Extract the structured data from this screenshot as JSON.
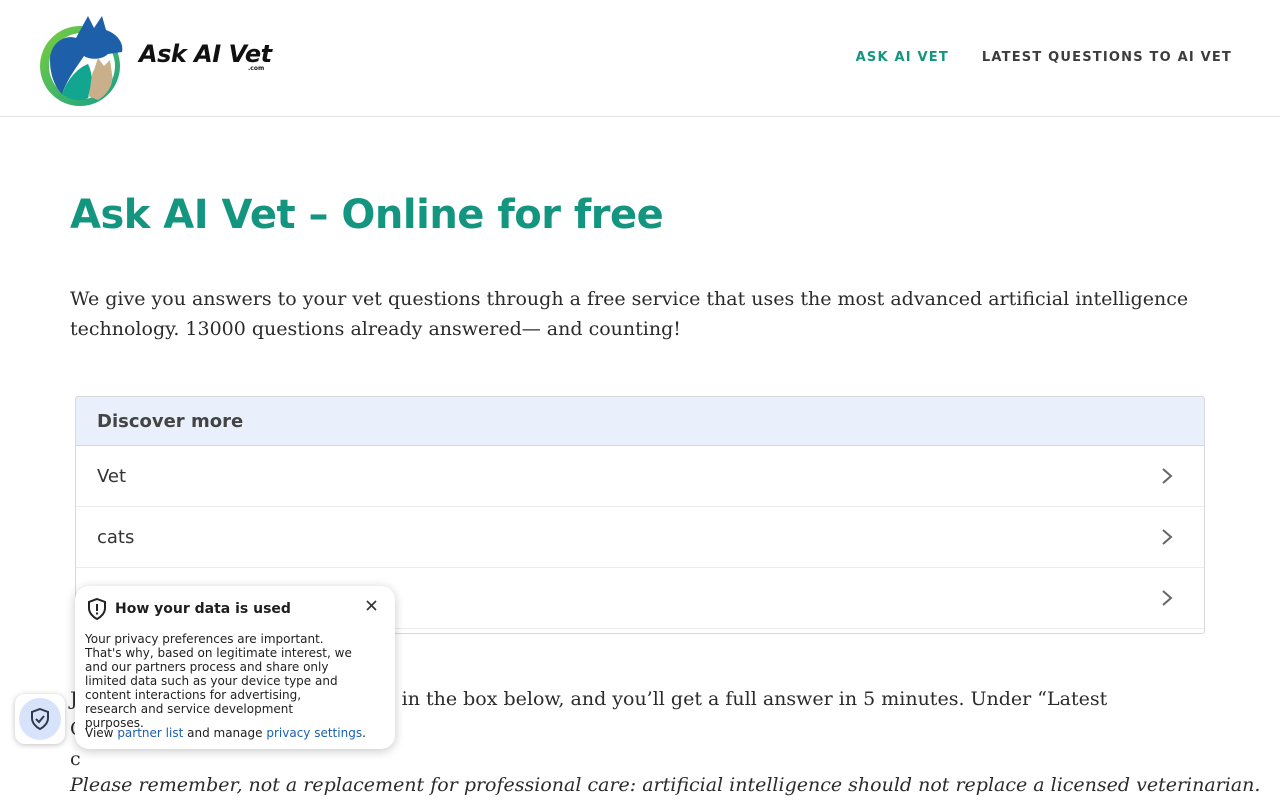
{
  "header": {
    "logo_text": "Ask AI Vet",
    "logo_sub": ".com",
    "nav": [
      {
        "label": "ASK AI VET",
        "active": true
      },
      {
        "label": "LATEST QUESTIONS TO AI VET",
        "active": false
      }
    ]
  },
  "main": {
    "title": "Ask AI Vet – Online for free",
    "intro": "We give you answers to your vet questions through a free service that uses the most advanced artificial intelligence technology. 13000 questions already answered— and counting!",
    "discover": {
      "heading": "Discover more",
      "items": [
        "Vet",
        "cats",
        ""
      ]
    },
    "body_text_visible": "in the box below, and you’ll get a full answer in 5 minutes. Under “Latest Questions,” you",
    "body_text_lead": "J",
    "body_text_line2": "c",
    "disclaimer": "Please remember, not a replacement for professional care: artificial intelligence should not replace a licensed veterinarian."
  },
  "privacy_popup": {
    "title": "How your data is used",
    "body": "Your privacy preferences are important. That's why, based on legitimate interest, we and our partners process and share only limited data such as your device type and content interactions for advertising, research and service development purposes.",
    "foot_view": "View",
    "foot_partner_link": "partner list",
    "foot_and_manage": "and manage",
    "foot_settings_link": "privacy settings",
    "foot_period": "."
  },
  "colors": {
    "brand": "#14957f",
    "discover_header_bg": "#e9f0fb",
    "link": "#1a5fb4"
  },
  "icons": [
    "logo-mark",
    "chevron-right-icon",
    "shield-check-icon",
    "shield-alert-icon",
    "close-icon"
  ]
}
